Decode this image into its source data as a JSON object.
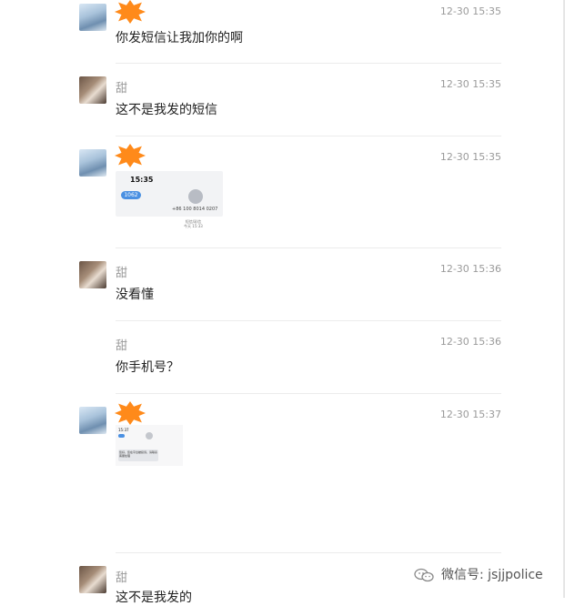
{
  "messages": [
    {
      "avatar": "mountain-avatar",
      "name": "",
      "redacted": true,
      "time": "12-30 15:35",
      "text": "你发短信让我加你的啊"
    },
    {
      "avatar": "portrait-avatar",
      "name": "甜",
      "redacted": false,
      "time": "12-30 15:35",
      "text": "这不是我发的短信"
    },
    {
      "avatar": "mountain-avatar",
      "name": "",
      "redacted": true,
      "time": "12-30 15:35",
      "image": {
        "clock": "15:35",
        "back_label": "1062",
        "phone": "+86 100 8014 0207",
        "caption_line1": "短信/彩信",
        "caption_line2": "今天 15:33"
      }
    },
    {
      "avatar": "portrait-avatar",
      "name": "甜",
      "redacted": false,
      "time": "12-30 15:36",
      "text": "没看懂"
    },
    {
      "avatar": "none",
      "name": "甜",
      "redacted": false,
      "time": "12-30 15:36",
      "text": "你手机号？"
    },
    {
      "avatar": "mountain-avatar",
      "name": "",
      "redacted": true,
      "time": "12-30 15:37",
      "image": {
        "clock": "15:37",
        "bubble_text": "您好，您在平台被投诉，请联系客服处理"
      }
    },
    {
      "avatar": "portrait-avatar",
      "name": "甜",
      "redacted": false,
      "time": "",
      "text": "这不是我发的"
    }
  ],
  "watermark": {
    "icon": "wechat-icon",
    "text": "微信号: jsjjpolice"
  },
  "colors": {
    "redaction": "#ff8a1a",
    "timestamp": "#9a9a9a",
    "name": "#999999",
    "divider": "#ececec"
  }
}
